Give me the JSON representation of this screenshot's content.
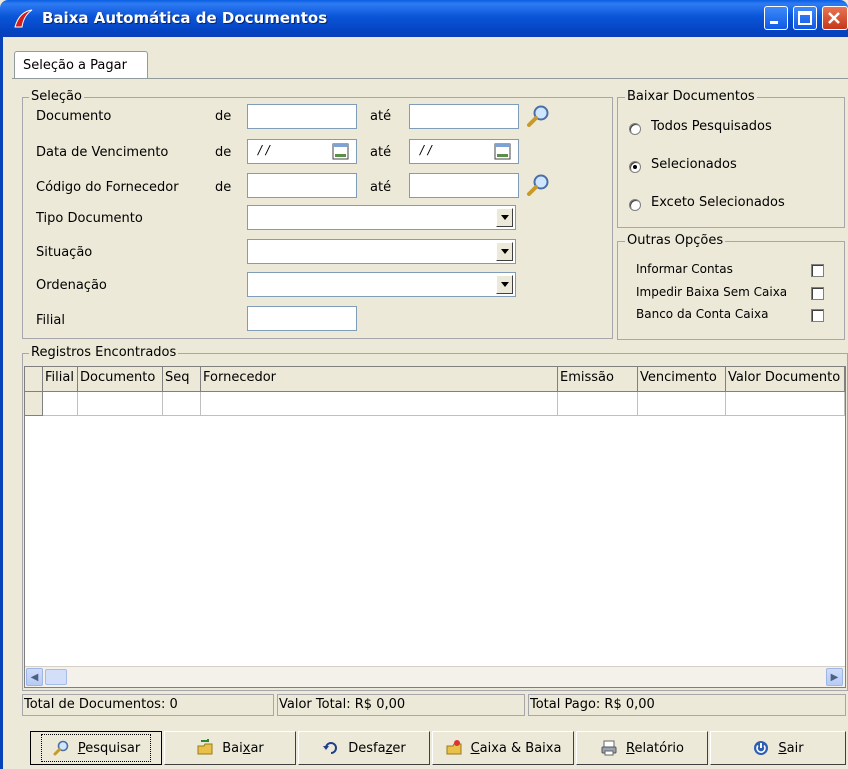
{
  "window": {
    "title": "Baixa Automática de Documentos"
  },
  "tabs": [
    {
      "label": "Seleção a Pagar"
    }
  ],
  "selecao": {
    "title": "Seleção",
    "rows": [
      {
        "label": "Documento",
        "de": "de",
        "ate": "até",
        "from_value": "",
        "to_value": ""
      },
      {
        "label": "Data de Vencimento",
        "de": "de",
        "ate": "até",
        "from_value": " / /",
        "to_value": " / /"
      },
      {
        "label": "Código do Fornecedor",
        "de": "de",
        "ate": "até",
        "from_value": "",
        "to_value": ""
      }
    ],
    "tipo_documento": {
      "label": "Tipo Documento",
      "value": ""
    },
    "situacao": {
      "label": "Situação",
      "value": ""
    },
    "ordenacao": {
      "label": "Ordenação",
      "value": ""
    },
    "filial": {
      "label": "Filial",
      "value": ""
    }
  },
  "baixar_documentos": {
    "title": "Baixar Documentos",
    "options": [
      {
        "label": "Todos Pesquisados",
        "selected": false
      },
      {
        "label": "Selecionados",
        "selected": true
      },
      {
        "label": "Exceto Selecionados",
        "selected": false
      }
    ]
  },
  "outras_opcoes": {
    "title": "Outras Opções",
    "options": [
      {
        "label": "Informar Contas",
        "checked": false
      },
      {
        "label": "Impedir Baixa Sem Caixa",
        "checked": false
      },
      {
        "label": "Banco da Conta Caixa",
        "checked": false
      }
    ]
  },
  "registros": {
    "title": "Registros Encontrados",
    "columns": [
      "Filial",
      "Documento",
      "Seq",
      "Fornecedor",
      "Emissão",
      "Vencimento",
      "Valor Documento"
    ]
  },
  "status": {
    "total_documentos": "Total de Documentos: 0",
    "valor_total": "Valor Total: R$ 0,00",
    "total_pago": "Total Pago: R$ 0,00"
  },
  "buttons": {
    "pesquisar": {
      "pre": "",
      "hot": "P",
      "post": "esquisar"
    },
    "baixar": {
      "pre": "Bai",
      "hot": "x",
      "post": "ar"
    },
    "desfazer": {
      "pre": "Desfa",
      "hot": "z",
      "post": "er"
    },
    "caixa_baixa": {
      "pre": "",
      "hot": "C",
      "post": "aixa & Baixa"
    },
    "relatorio": {
      "pre": "",
      "hot": "R",
      "post": "elatório"
    },
    "sair": {
      "pre": "",
      "hot": "S",
      "post": "air"
    }
  },
  "icons": {
    "search": "magnifier-icon",
    "calendar": "calendar-icon",
    "app": "app-logo-icon"
  }
}
